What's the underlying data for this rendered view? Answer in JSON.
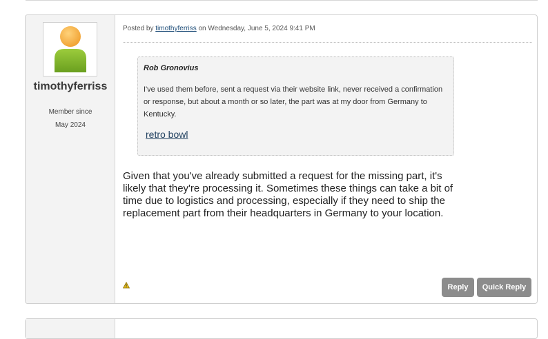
{
  "post": {
    "author": {
      "username": "timothyferriss",
      "member_since_label": "Member since",
      "member_since_date": "May 2024",
      "avatar_icon": "user-avatar-icon"
    },
    "meta": {
      "posted_by_label": "Posted by",
      "author_link": "timothyferriss",
      "date_text": "on Wednesday, June 5, 2024 9:41 PM"
    },
    "quote": {
      "author": "Rob Gronovius",
      "text": "I've used them before, sent a request via their website link, never received a confirmation or response, but about a month or so later, the part was at my door from Germany to Kentucky.",
      "link_text": "retro bowl"
    },
    "body": "Given that you've already submitted a request for the missing part, it's likely that they're processing it. Sometimes these things can take a bit of time due to logistics and processing, especially if they need to ship the replacement part from their headquarters in Germany to your location.",
    "actions": {
      "report_icon": "warning-icon",
      "reply_label": "Reply",
      "quick_reply_label": "Quick Reply"
    }
  },
  "colors": {
    "button_bg": "#8c8c8c",
    "panel_bg": "#f3f3f3",
    "link": "#1f4e79"
  }
}
